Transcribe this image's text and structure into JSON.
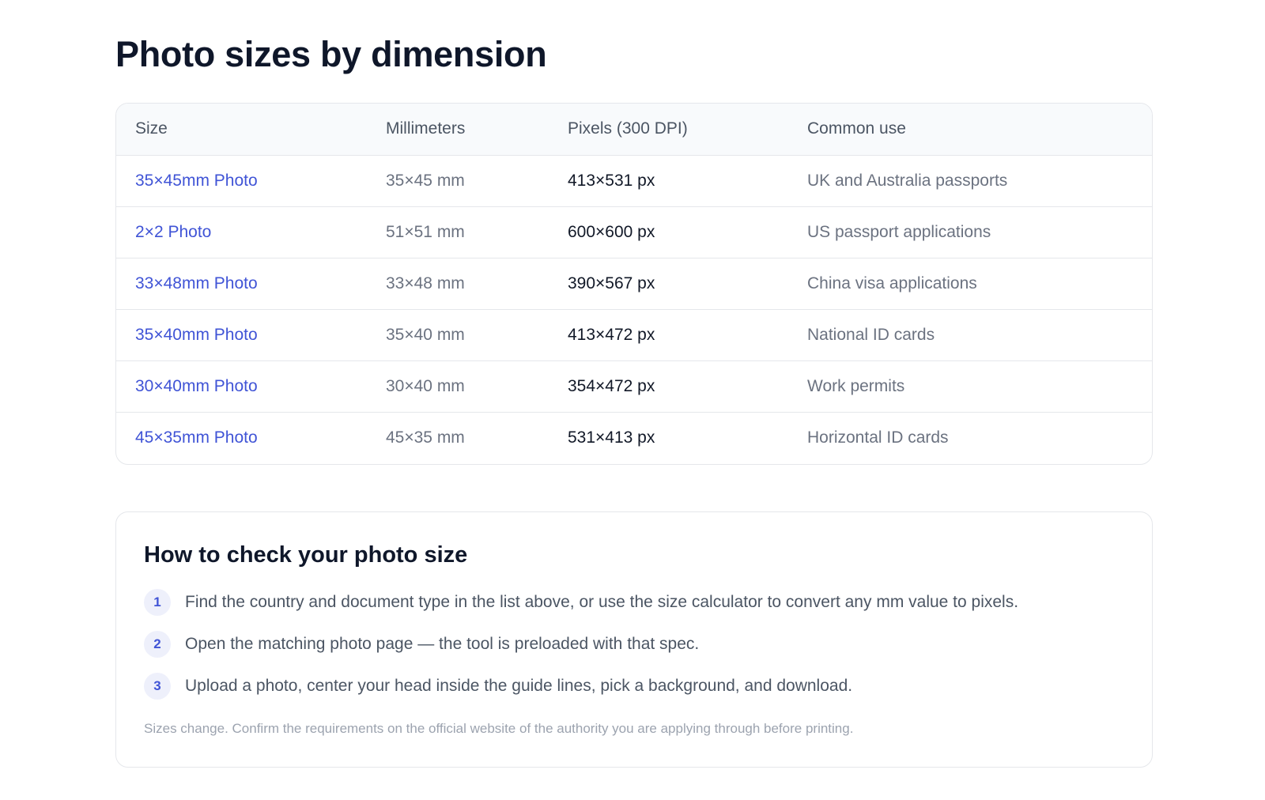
{
  "page": {
    "title": "Photo sizes by dimension"
  },
  "table": {
    "headers": [
      "Size",
      "Millimeters",
      "Pixels (300 DPI)",
      "Common use"
    ],
    "rows": [
      {
        "size": "35×45mm Photo",
        "mm": "35×45 mm",
        "px": "413×531 px",
        "use": "UK and Australia passports"
      },
      {
        "size": "2×2 Photo",
        "mm": "51×51 mm",
        "px": "600×600 px",
        "use": "US passport applications"
      },
      {
        "size": "33×48mm Photo",
        "mm": "33×48 mm",
        "px": "390×567 px",
        "use": "China visa applications"
      },
      {
        "size": "35×40mm Photo",
        "mm": "35×40 mm",
        "px": "413×472 px",
        "use": "National ID cards"
      },
      {
        "size": "30×40mm Photo",
        "mm": "30×40 mm",
        "px": "354×472 px",
        "use": "Work permits"
      },
      {
        "size": "45×35mm Photo",
        "mm": "45×35 mm",
        "px": "531×413 px",
        "use": "Horizontal ID cards"
      }
    ]
  },
  "howto": {
    "title": "How to check your photo size",
    "steps": [
      {
        "num": "1",
        "text": "Find the country and document type in the list above, or use the size calculator to convert any mm value to pixels."
      },
      {
        "num": "2",
        "text": "Open the matching photo page — the tool is preloaded with that spec."
      },
      {
        "num": "3",
        "text": "Upload a photo, center your head inside the guide lines, pick a background, and download."
      }
    ],
    "note": "Sizes change. Confirm the requirements on the official website of the authority you are applying through before printing."
  },
  "colors": {
    "link": "#4054d6",
    "header_bg": "#f8fafc",
    "border": "#e5e7eb",
    "step_badge_bg": "#eef0fb"
  }
}
